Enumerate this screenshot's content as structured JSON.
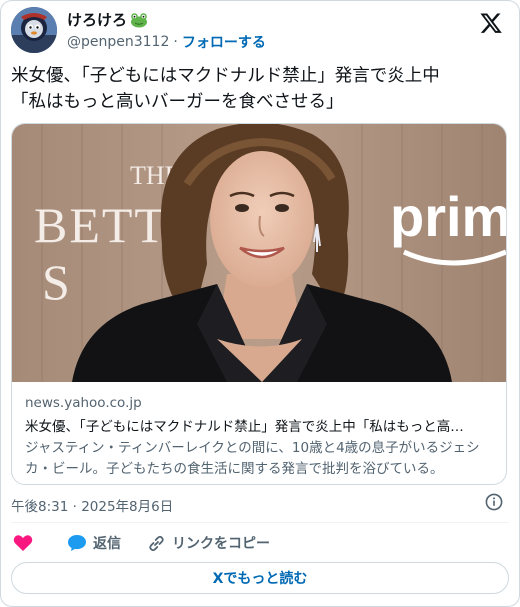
{
  "author": {
    "display_name": "けろけろ",
    "handle": "@penpen3112",
    "separator": "·",
    "follow_label": "フォローする"
  },
  "tweet": {
    "text_lines": [
      "米女優、「子どもにはマクドナルド禁止」発言で炎上中",
      "「私はもっと高いバーガーを食べさせる」"
    ]
  },
  "link_card": {
    "domain": "news.yahoo.co.jp",
    "title": "米女優、「子どもにはマクドナルド禁止」発言で炎上中「私はもっと高…",
    "description": "ジャスティン・ティンバーレイクとの間に、10歳と4歳の息子がいるジェシカ・ビール。子どもたちの食生活に関する発言で批判を浴びている。",
    "backdrop_text": {
      "left_top": "THE",
      "left_mid": "BETT",
      "left_bottom": "S",
      "right": "prim"
    }
  },
  "timestamp": "午後8:31 · 2025年8月6日",
  "actions": {
    "reply_label": "返信",
    "copy_link_label": "リンクをコピー"
  },
  "read_more_label": "Xでもっと読む",
  "colors": {
    "accent_link": "#0069b4",
    "like_heart": "#f91880",
    "reply_bubble": "#1d9bf0",
    "border": "#cfd9de",
    "secondary_text": "#536471"
  },
  "icons": [
    "x-logo-icon",
    "frog-emoji-icon",
    "heart-icon",
    "reply-bubble-icon",
    "link-icon",
    "info-icon"
  ]
}
